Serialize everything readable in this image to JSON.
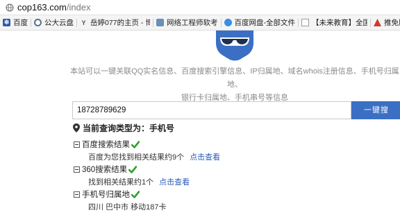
{
  "browser": {
    "url_host": "cop163.com",
    "url_path": "/index"
  },
  "bookmarks": [
    {
      "label": "百度",
      "icon": "baidu-paw-icon"
    },
    {
      "label": "公大云盘",
      "icon": "target-icon"
    },
    {
      "label": "岳婷077的主页 - 博客",
      "icon": "y-logo-icon"
    },
    {
      "label": "网络工程师软考",
      "icon": "network-icon"
    },
    {
      "label": "百度网盘-全部文件",
      "icon": "cloud-icon"
    },
    {
      "label": "【未来教育】全国计算",
      "icon": "page-icon"
    },
    {
      "label": "推免服务",
      "icon": "red-triangle-icon"
    }
  ],
  "page": {
    "description_line1": "本站可以一键关联QQ实名信息、百度搜索引擎信息、IP归属地、域名whois注册信息、手机号归属地、",
    "description_line2": "银行卡归属地、手机串号等信息",
    "search": {
      "value": "18728789629",
      "button_label": "一键搜"
    },
    "query_type": "当前查询类型为：手机号",
    "sections": [
      {
        "title": "百度搜索结果",
        "result": "百度为您找到相关结果约9个",
        "link": "点击查看"
      },
      {
        "title": "360搜索结果",
        "result": "找到相关结果约1个",
        "link": "点击查看"
      },
      {
        "title": "手机号归属地",
        "result": "四川 巴中市 移动187卡"
      }
    ]
  },
  "colors": {
    "accent": "#3a6fc4",
    "link": "#2a5cb8",
    "check": "#2fa02f"
  }
}
